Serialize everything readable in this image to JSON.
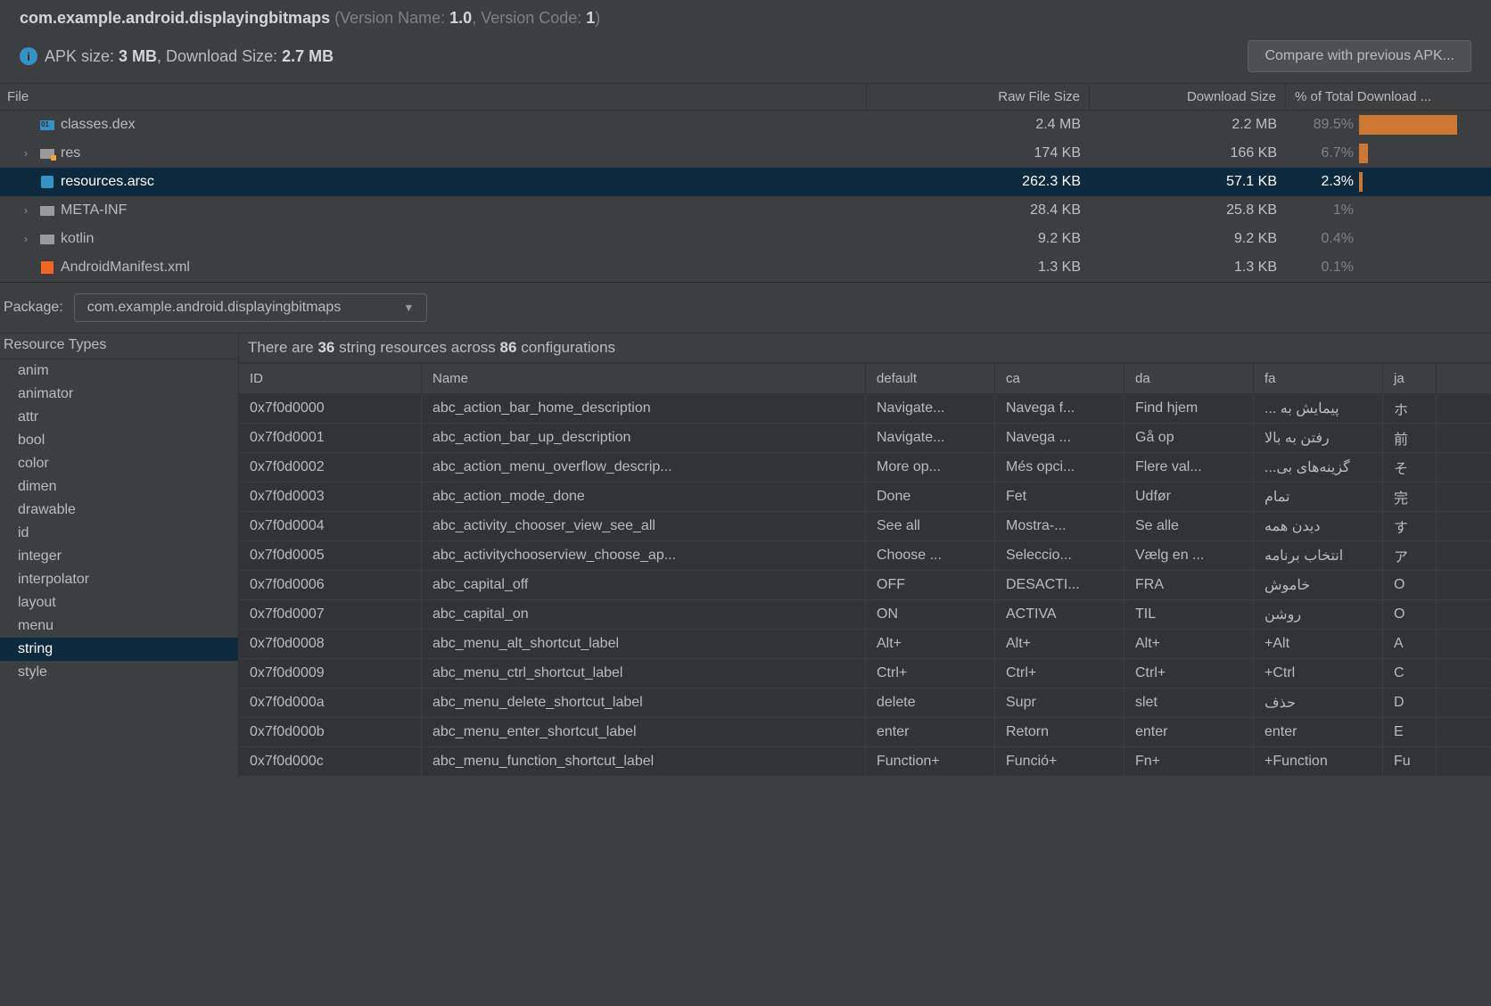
{
  "header": {
    "package": "com.example.android.displayingbitmaps",
    "versionNameLabel": " (Version Name: ",
    "versionName": "1.0",
    "versionCodeLabel": ", Version Code: ",
    "versionCode": "1",
    "close": ")",
    "apkSizeLabel": "APK size: ",
    "apkSize": "3 MB",
    "dlSizeLabel": ", Download Size: ",
    "dlSize": "2.7 MB",
    "compareBtn": "Compare with previous APK..."
  },
  "fileCols": {
    "file": "File",
    "raw": "Raw File Size",
    "dl": "Download Size",
    "pct": "% of Total Download ..."
  },
  "files": [
    {
      "name": "classes.dex",
      "raw": "2.4 MB",
      "dl": "2.2 MB",
      "pct": "89.5%",
      "bar": 100,
      "expand": false,
      "icon": "dex"
    },
    {
      "name": "res",
      "raw": "174 KB",
      "dl": "166 KB",
      "pct": "6.7%",
      "bar": 9,
      "expand": true,
      "icon": "folder-y"
    },
    {
      "name": "resources.arsc",
      "raw": "262.3 KB",
      "dl": "57.1 KB",
      "pct": "2.3%",
      "bar": 4,
      "expand": false,
      "icon": "arsc",
      "selected": true
    },
    {
      "name": "META-INF",
      "raw": "28.4 KB",
      "dl": "25.8 KB",
      "pct": "1%",
      "bar": 0,
      "expand": true,
      "icon": "folder"
    },
    {
      "name": "kotlin",
      "raw": "9.2 KB",
      "dl": "9.2 KB",
      "pct": "0.4%",
      "bar": 0,
      "expand": true,
      "icon": "folder"
    },
    {
      "name": "AndroidManifest.xml",
      "raw": "1.3 KB",
      "dl": "1.3 KB",
      "pct": "0.1%",
      "bar": 0,
      "expand": false,
      "icon": "xml"
    }
  ],
  "packageRow": {
    "label": "Package:",
    "value": "com.example.android.displayingbitmaps"
  },
  "resTypes": {
    "head": "Resource Types",
    "items": [
      "anim",
      "animator",
      "attr",
      "bool",
      "color",
      "dimen",
      "drawable",
      "id",
      "integer",
      "interpolator",
      "layout",
      "menu",
      "string",
      "style"
    ],
    "selected": "string"
  },
  "summary": {
    "p1": "There are ",
    "n1": "36",
    "p2": " string resources across ",
    "n2": "86",
    "p3": " configurations"
  },
  "strCols": {
    "id": "ID",
    "name": "Name",
    "def": "default",
    "ca": "ca",
    "da": "da",
    "fa": "fa",
    "ja": "ja"
  },
  "strings": [
    {
      "id": "0x7f0d0000",
      "name": "abc_action_bar_home_description",
      "def": "Navigate...",
      "ca": "Navega f...",
      "da": "Find hjem",
      "fa": "پیمایش به ...",
      "ja": "ホ"
    },
    {
      "id": "0x7f0d0001",
      "name": "abc_action_bar_up_description",
      "def": "Navigate...",
      "ca": "Navega ...",
      "da": "Gå op",
      "fa": "رفتن به بالا",
      "ja": "前"
    },
    {
      "id": "0x7f0d0002",
      "name": "abc_action_menu_overflow_descrip...",
      "def": "More op...",
      "ca": "Més opci...",
      "da": "Flere val...",
      "fa": "گزینه‌های بی...",
      "ja": "そ"
    },
    {
      "id": "0x7f0d0003",
      "name": "abc_action_mode_done",
      "def": "Done",
      "ca": "Fet",
      "da": "Udfør",
      "fa": "تمام",
      "ja": "完"
    },
    {
      "id": "0x7f0d0004",
      "name": "abc_activity_chooser_view_see_all",
      "def": "See all",
      "ca": "Mostra-...",
      "da": "Se alle",
      "fa": "دیدن همه",
      "ja": "す"
    },
    {
      "id": "0x7f0d0005",
      "name": "abc_activitychooserview_choose_ap...",
      "def": "Choose ...",
      "ca": "Seleccio...",
      "da": "Vælg en ...",
      "fa": "انتخاب برنامه",
      "ja": "ア"
    },
    {
      "id": "0x7f0d0006",
      "name": "abc_capital_off",
      "def": "OFF",
      "ca": "DESACTI...",
      "da": "FRA",
      "fa": "خاموش",
      "ja": "O"
    },
    {
      "id": "0x7f0d0007",
      "name": "abc_capital_on",
      "def": "ON",
      "ca": "ACTIVA",
      "da": "TIL",
      "fa": "روشن",
      "ja": "O"
    },
    {
      "id": "0x7f0d0008",
      "name": "abc_menu_alt_shortcut_label",
      "def": "Alt+",
      "ca": "Alt+",
      "da": "Alt+",
      "fa": "Alt+",
      "ja": "A"
    },
    {
      "id": "0x7f0d0009",
      "name": "abc_menu_ctrl_shortcut_label",
      "def": "Ctrl+",
      "ca": "Ctrl+",
      "da": "Ctrl+",
      "fa": "Ctrl+",
      "ja": "C"
    },
    {
      "id": "0x7f0d000a",
      "name": "abc_menu_delete_shortcut_label",
      "def": "delete",
      "ca": "Supr",
      "da": "slet",
      "fa": "حذف",
      "ja": "D"
    },
    {
      "id": "0x7f0d000b",
      "name": "abc_menu_enter_shortcut_label",
      "def": "enter",
      "ca": "Retorn",
      "da": "enter",
      "fa": "enter",
      "ja": "E"
    },
    {
      "id": "0x7f0d000c",
      "name": "abc_menu_function_shortcut_label",
      "def": "Function+",
      "ca": "Funció+",
      "da": "Fn+",
      "fa": "Function+",
      "ja": "Fu"
    }
  ]
}
